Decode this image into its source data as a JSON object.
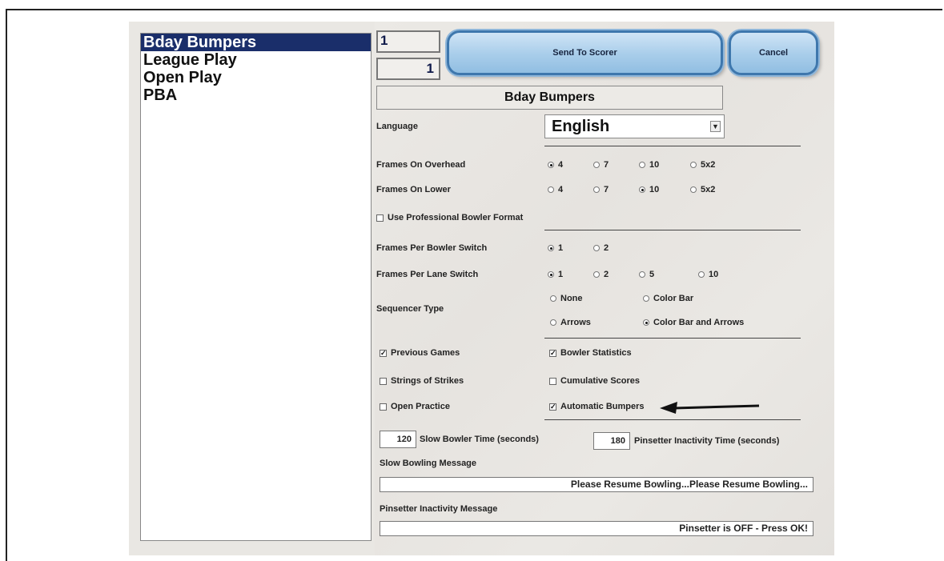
{
  "sidebar": {
    "items": [
      {
        "label": "Bday Bumpers",
        "selected": true
      },
      {
        "label": "League Play",
        "selected": false
      },
      {
        "label": "Open Play",
        "selected": false
      },
      {
        "label": "PBA",
        "selected": false
      }
    ]
  },
  "header": {
    "number_top": "1",
    "number_bottom": "1",
    "send_button": "Send To Scorer",
    "cancel_button": "Cancel",
    "profile_title": "Bday Bumpers"
  },
  "language": {
    "label": "Language",
    "value": "English"
  },
  "frames_on_overhead": {
    "label": "Frames On Overhead",
    "options": [
      "4",
      "7",
      "10",
      "5x2"
    ],
    "selected": "4"
  },
  "frames_on_lower": {
    "label": "Frames On Lower",
    "options": [
      "4",
      "7",
      "10",
      "5x2"
    ],
    "selected": "10"
  },
  "professional_format": {
    "label": "Use Professional Bowler Format",
    "checked": false
  },
  "frames_per_bowler_switch": {
    "label": "Frames Per Bowler Switch",
    "options": [
      "1",
      "2"
    ],
    "selected": "1"
  },
  "frames_per_lane_switch": {
    "label": "Frames Per Lane Switch",
    "options": [
      "1",
      "2",
      "5",
      "10"
    ],
    "selected": "1"
  },
  "sequencer_type": {
    "label": "Sequencer Type",
    "options": [
      "None",
      "Color Bar",
      "Arrows",
      "Color Bar and Arrows"
    ],
    "selected": "Color Bar and Arrows"
  },
  "checkboxes": {
    "previous_games": {
      "label": "Previous Games",
      "checked": true
    },
    "bowler_statistics": {
      "label": "Bowler Statistics",
      "checked": true
    },
    "strings_of_strikes": {
      "label": "Strings of Strikes",
      "checked": false
    },
    "cumulative_scores": {
      "label": "Cumulative Scores",
      "checked": false
    },
    "open_practice": {
      "label": "Open Practice",
      "checked": false
    },
    "automatic_bumpers": {
      "label": "Automatic Bumpers",
      "checked": true
    }
  },
  "timers": {
    "slow_bowler_value": "120",
    "slow_bowler_label": "Slow Bowler Time (seconds)",
    "pinsetter_value": "180",
    "pinsetter_label": "Pinsetter Inactivity Time (seconds)"
  },
  "messages": {
    "slow_label": "Slow Bowling Message",
    "slow_value": "Please Resume Bowling...Please Resume Bowling...",
    "pinsetter_label": "Pinsetter Inactivity Message",
    "pinsetter_value": "Pinsetter is OFF - Press OK!"
  },
  "colors": {
    "selection": "#1a2e6a",
    "button": "#a8cdea"
  }
}
